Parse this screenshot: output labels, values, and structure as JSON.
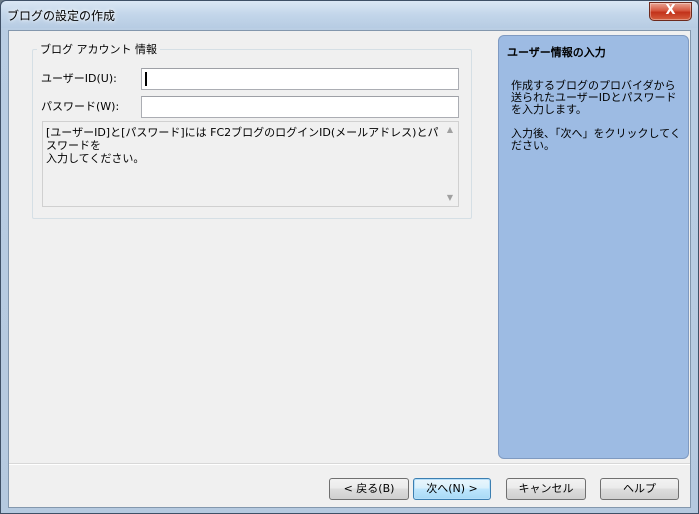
{
  "window": {
    "title": "ブログの設定の作成",
    "close_label": "X"
  },
  "account_group": {
    "legend": "ブログ アカウント 情報",
    "user_label": "ユーザーID(U):",
    "user_value": "",
    "password_label": "パスワード(W):",
    "password_value": "",
    "info_text": "[ユーザーID]と[パスワード]には FC2ブログのログインID(メールアドレス)とパスワードを\n入力してください。",
    "scroll_up_glyph": "▲",
    "scroll_down_glyph": "▼"
  },
  "side_panel": {
    "title": "ユーザー情報の入力",
    "body": "作成するブログのプロバイダから送られたユーザーIDとパスワードを入力します。\n\n入力後、「次へ」をクリックしてください。"
  },
  "footer": {
    "back_label": "< 戻る(B)",
    "next_label": "次へ(N) >",
    "cancel_label": "キャンセル",
    "help_label": "ヘルプ"
  }
}
